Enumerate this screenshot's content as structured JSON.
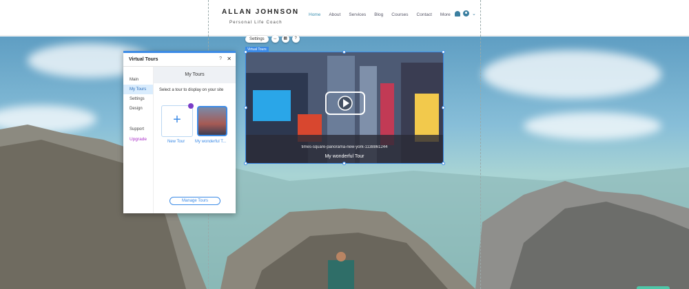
{
  "site": {
    "brand": "ALLAN JOHNSON",
    "tagline": "Personal Life Coach",
    "nav": [
      "Home",
      "About",
      "Services",
      "Blog",
      "Courses",
      "Contact",
      "More"
    ],
    "active_nav": "Home"
  },
  "toolbar": {
    "settings_label": "Settings",
    "icons": [
      "stretch-icon",
      "store-icon",
      "help-icon"
    ]
  },
  "widget": {
    "tag": "Virtual Tours",
    "url": "times-square-panorama-new-york-1138861244",
    "tour_name": "My wonderful Tour"
  },
  "panel": {
    "title": "Virtual Tours",
    "help": "?",
    "close": "✕",
    "sidebar": [
      {
        "label": "Main"
      },
      {
        "label": "My Tours"
      },
      {
        "label": "Settings"
      },
      {
        "label": "Design"
      },
      {
        "label": "Support"
      },
      {
        "label": "Upgrade"
      }
    ],
    "header": "My Tours",
    "subtitle": "Select a tour to display on your site",
    "new_tile_label": "New Tour",
    "thumb_label": "My wonderful T...",
    "manage_button": "Manage Tours"
  },
  "colors": {
    "accent": "#3b8ae6",
    "upgrade": "#aa2fc8",
    "nav_active": "#3a8fb0"
  }
}
